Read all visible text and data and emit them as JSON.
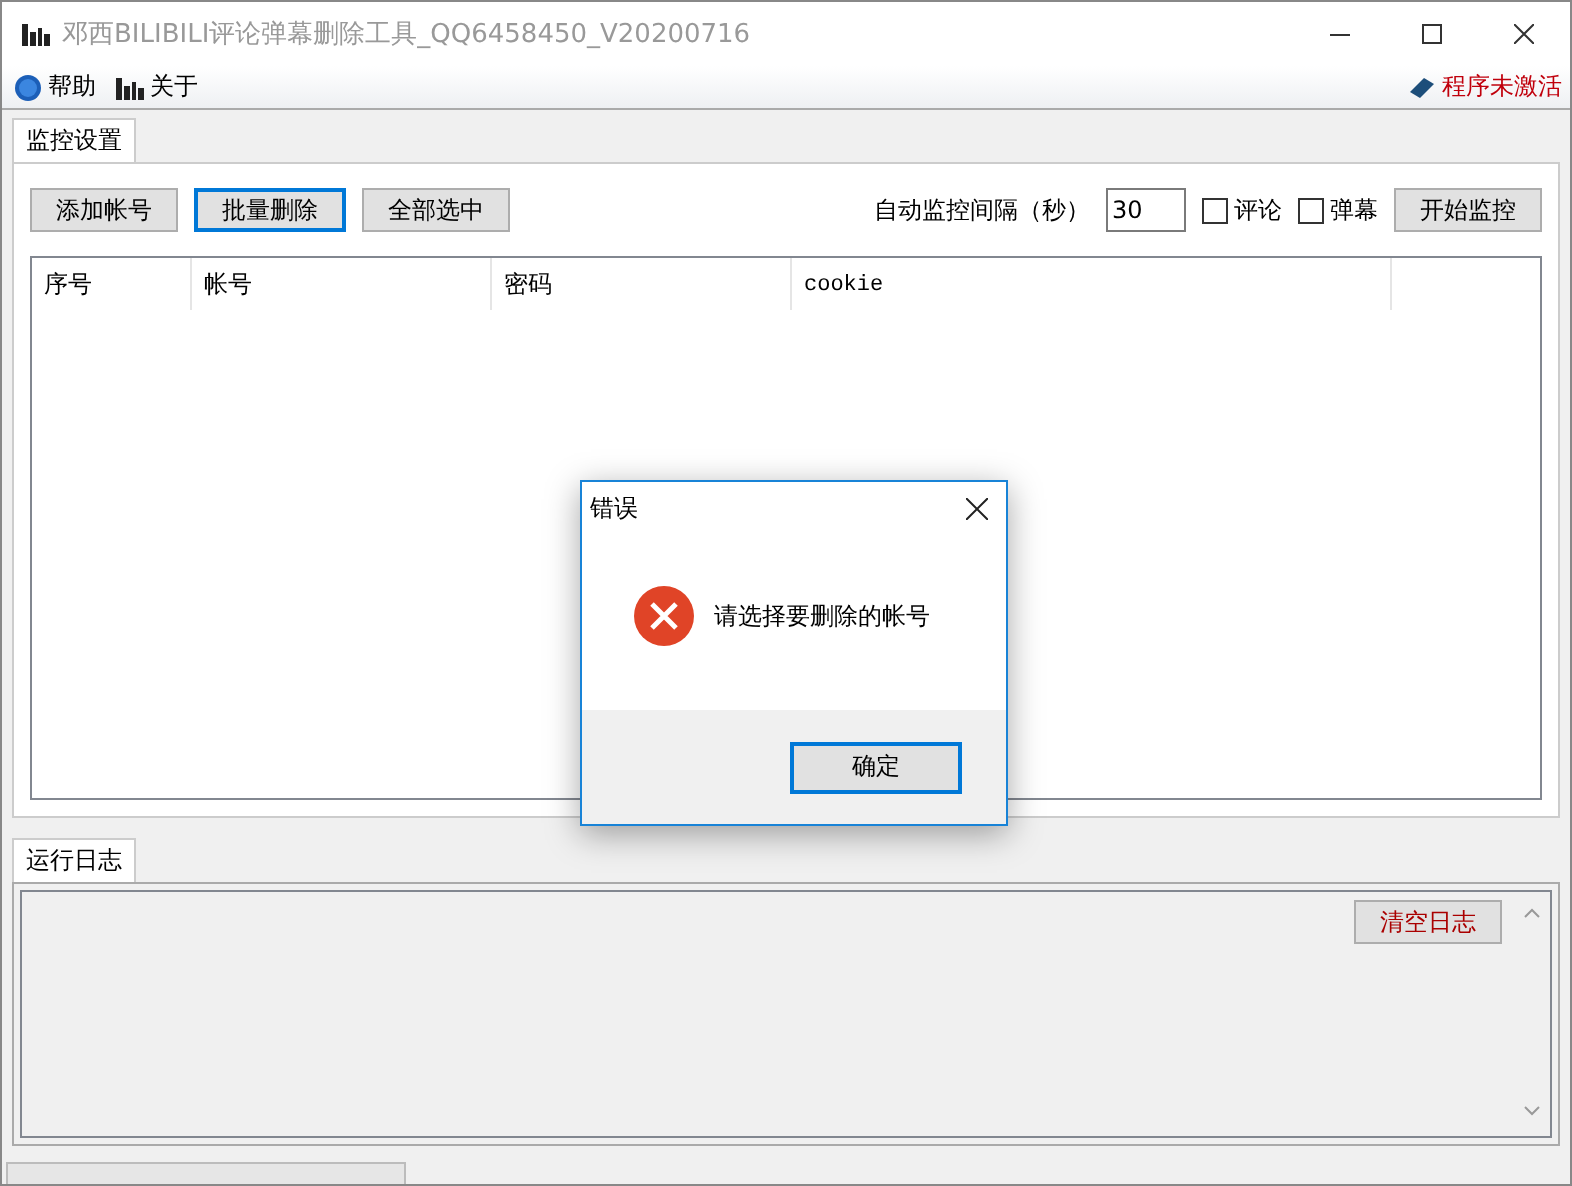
{
  "window": {
    "title": "邓西BILIBILI评论弹幕删除工具_QQ6458450_V20200716"
  },
  "menu": [
    {
      "label": "帮助",
      "kind": "help"
    },
    {
      "label": "关于",
      "kind": "about"
    }
  ],
  "activation": "程序未激活",
  "tabs": [
    {
      "label": "监控设置",
      "selected": true
    }
  ],
  "buttons": [
    {
      "label": "添加帐号",
      "focused": false
    },
    {
      "label": "批量删除",
      "focused": true
    },
    {
      "label": "全部选中",
      "focused": false
    }
  ],
  "interval": {
    "label": "自动监控间隔（秒）",
    "value": "30"
  },
  "options": [
    {
      "label": "评论",
      "checked": false
    },
    {
      "label": "弹幕",
      "checked": false
    }
  ],
  "start_button": "开始监控",
  "table": {
    "columns": [
      "序号",
      "帐号",
      "密码",
      "cookie"
    ]
  },
  "log": {
    "tab": {
      "label": "运行日志",
      "selected": true
    },
    "clear_button": "清空日志"
  },
  "progress": {
    "level": 0
  },
  "dialog": {
    "title": "错误",
    "message": "请选择要删除的帐号",
    "button": "确定"
  }
}
